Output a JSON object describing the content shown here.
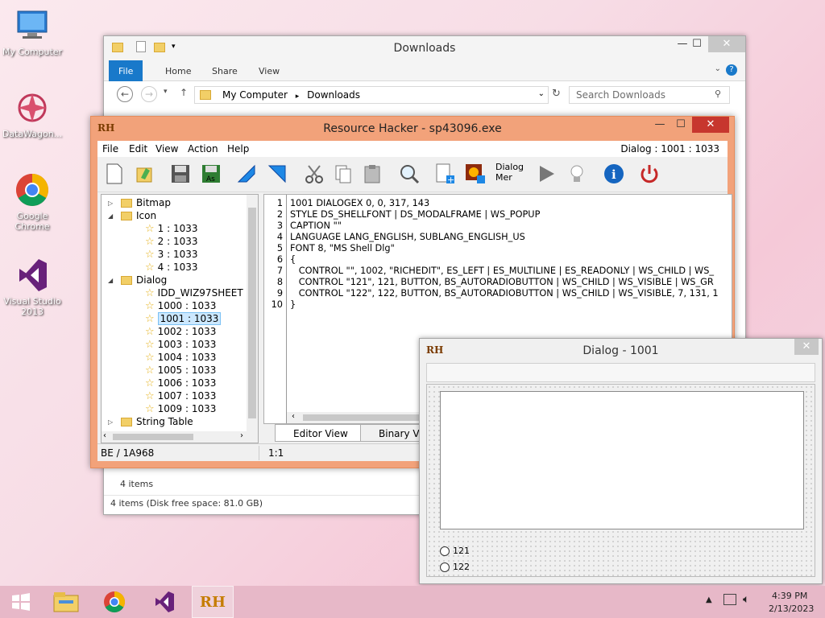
{
  "desktop": {
    "icons": [
      {
        "label": "My Computer"
      },
      {
        "label": "DataWagon..."
      },
      {
        "label": "Google Chrome"
      },
      {
        "label": "Visual Studio 2013"
      }
    ]
  },
  "explorer": {
    "title": "Downloads",
    "tabs": [
      "File",
      "Home",
      "Share",
      "View"
    ],
    "breadcrumb": [
      "My Computer",
      "Downloads"
    ],
    "search_placeholder": "Search Downloads",
    "items_count": "4 items",
    "status": "4 items (Disk free space: 81.0 GB)"
  },
  "rh": {
    "logo": "RH",
    "title": "Resource Hacker - sp43096.exe",
    "menu": [
      "File",
      "Edit",
      "View",
      "Action",
      "Help"
    ],
    "menu_info": "Dialog : 1001 : 1033",
    "toolbar": {
      "dialog_menu_label_1": "Dialog",
      "dialog_menu_label_2": "Mer"
    },
    "tree": [
      {
        "label": "Bitmap",
        "type": "folder",
        "level": 0
      },
      {
        "label": "Icon",
        "type": "folder",
        "level": 0
      },
      {
        "label": "1 : 1033",
        "type": "item",
        "level": 1
      },
      {
        "label": "2 : 1033",
        "type": "item",
        "level": 1
      },
      {
        "label": "3 : 1033",
        "type": "item",
        "level": 1
      },
      {
        "label": "4 : 1033",
        "type": "item",
        "level": 1
      },
      {
        "label": "Dialog",
        "type": "folder",
        "level": 0
      },
      {
        "label": "IDD_WIZ97SHEET",
        "type": "item",
        "level": 1
      },
      {
        "label": "1000 : 1033",
        "type": "item",
        "level": 1
      },
      {
        "label": "1001 : 1033",
        "type": "item",
        "level": 1,
        "selected": true
      },
      {
        "label": "1002 : 1033",
        "type": "item",
        "level": 1
      },
      {
        "label": "1003 : 1033",
        "type": "item",
        "level": 1
      },
      {
        "label": "1004 : 1033",
        "type": "item",
        "level": 1
      },
      {
        "label": "1005 : 1033",
        "type": "item",
        "level": 1
      },
      {
        "label": "1006 : 1033",
        "type": "item",
        "level": 1
      },
      {
        "label": "1007 : 1033",
        "type": "item",
        "level": 1
      },
      {
        "label": "1009 : 1033",
        "type": "item",
        "level": 1
      },
      {
        "label": "String Table",
        "type": "folder",
        "level": 0
      }
    ],
    "code": [
      "1001 DIALOGEX 0, 0, 317, 143",
      "STYLE DS_SHELLFONT | DS_MODALFRAME | WS_POPUP",
      "CAPTION \"\"",
      "LANGUAGE LANG_ENGLISH, SUBLANG_ENGLISH_US",
      "FONT 8, \"MS Shell Dlg\"",
      "{",
      "   CONTROL \"\", 1002, \"RICHEDIT\", ES_LEFT | ES_MULTILINE | ES_READONLY | WS_CHILD | WS_",
      "   CONTROL \"121\", 121, BUTTON, BS_AUTORADIOBUTTON | WS_CHILD | WS_VISIBLE | WS_GR",
      "   CONTROL \"122\", 122, BUTTON, BS_AUTORADIOBUTTON | WS_CHILD | WS_VISIBLE, 7, 131, 1",
      "}"
    ],
    "editor_tabs": [
      "Editor View",
      "Binary Vie"
    ],
    "status_left": "BE / 1A968",
    "status_mid": "1:1"
  },
  "dialog": {
    "logo": "RH",
    "title": "Dialog - 1001",
    "radios": [
      "121",
      "122"
    ]
  },
  "taskbar": {
    "time": "4:39 PM",
    "date": "2/13/2023"
  }
}
